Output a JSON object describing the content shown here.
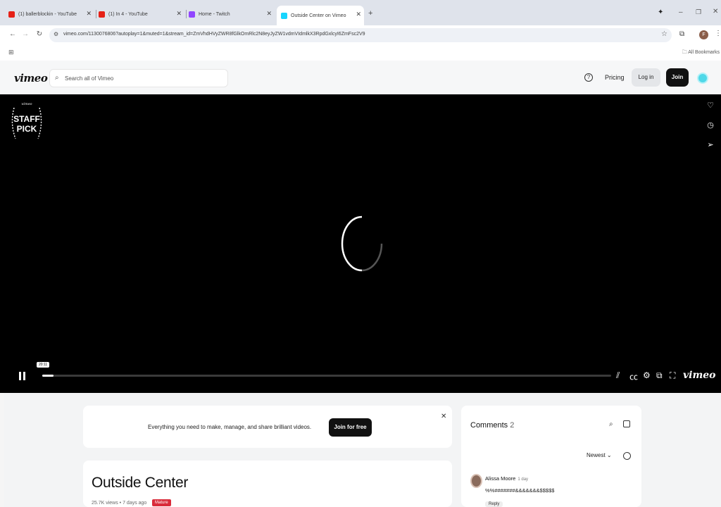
{
  "browser": {
    "tabs": [
      {
        "title": "(1) ballerblockin - YouTube",
        "favicon_color": "#e62117"
      },
      {
        "title": "(1) In 4 - YouTube",
        "favicon_color": "#e62117"
      },
      {
        "title": "Home - Twitch",
        "favicon_color": "#9146ff"
      },
      {
        "title": "Outside Center on Vimeo",
        "favicon_color": "#17d5ff",
        "active": true
      }
    ],
    "new_tab_symbol": "+",
    "url": "vimeo.com/1130076806?autoplay=1&muted=1&stream_id=ZmVhdHVyZWR8fGlkOmRlc2N8eyJyZW1vdmVIdmlkX3RpdGxlcyI6ZmFsc2V9",
    "all_bookmarks_label": "All Bookmarks",
    "profile_initial": "F"
  },
  "vimeo_header": {
    "logo": "vimeo",
    "search_placeholder": "Search all of Vimeo",
    "help_symbol": "?",
    "pricing_label": "Pricing",
    "login_label": "Log in",
    "join_label": "Join"
  },
  "player": {
    "badge_top": "vimeo",
    "badge_main": "STAFF PICK",
    "timecode": "20:11",
    "progress": 0.002,
    "watermark": "vimeo"
  },
  "promo": {
    "text": "Everything you need to make, manage, and share brilliant videos.",
    "button_label": "Join for free"
  },
  "video_info": {
    "title": "Outside Center",
    "meta": "25.7K views • 7 days ago",
    "badge": "Mature"
  },
  "comments": {
    "title": "Comments",
    "count": "2",
    "sort_label": "Newest",
    "items": [
      {
        "author": "Alissa Moore",
        "age": "1 day",
        "body": "%%#######&&&&&&&$$$$$",
        "reply_label": "Reply"
      }
    ]
  }
}
